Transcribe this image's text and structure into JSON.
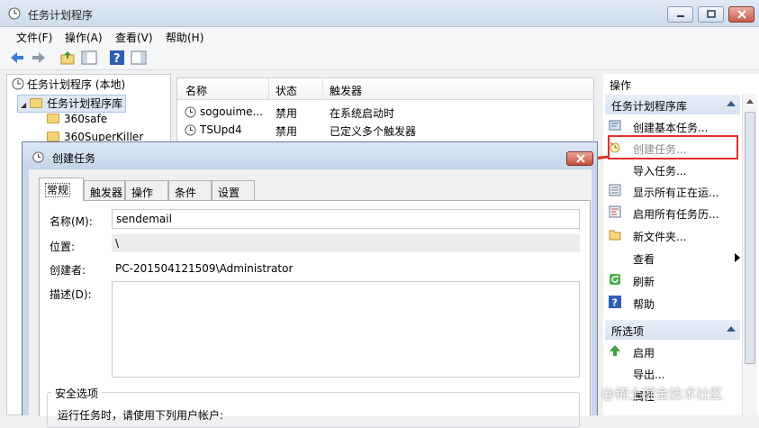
{
  "window": {
    "title": "任务计划程序"
  },
  "menu": [
    "文件(F)",
    "操作(A)",
    "查看(V)",
    "帮助(H)"
  ],
  "tree": {
    "root": "任务计划程序 (本地)",
    "library": "任务计划程序库",
    "folders": [
      "360safe",
      "360SuperKiller"
    ]
  },
  "list": {
    "columns": [
      "名称",
      "状态",
      "触发器"
    ],
    "rows": [
      {
        "name": "sogouime...",
        "status": "禁用",
        "trigger": "在系统启动时"
      },
      {
        "name": "TSUpd4",
        "status": "禁用",
        "trigger": "已定义多个触发器"
      }
    ]
  },
  "actions": {
    "header": "操作",
    "section1": "任务计划程序库",
    "items": [
      {
        "label": "创建基本任务...",
        "icon": "create-basic-task-icon"
      },
      {
        "label": "创建任务...",
        "icon": "create-task-icon"
      },
      {
        "label": "导入任务...",
        "icon": ""
      },
      {
        "label": "显示所有正在运...",
        "icon": "running-tasks-icon"
      },
      {
        "label": "启用所有任务历...",
        "icon": "history-icon"
      },
      {
        "label": "新文件夹...",
        "icon": "folder-icon"
      },
      {
        "label": "查看",
        "icon": ""
      },
      {
        "label": "刷新",
        "icon": "refresh-icon"
      },
      {
        "label": "帮助",
        "icon": "help-icon"
      }
    ],
    "section2": "所选项",
    "items2": [
      {
        "label": "启用",
        "icon": "enable-arrow-icon"
      },
      {
        "label": "导出...",
        "icon": ""
      },
      {
        "label": "属性",
        "icon": ""
      }
    ]
  },
  "dialog": {
    "title": "创建任务",
    "tabs": [
      "常规",
      "触发器",
      "操作",
      "条件",
      "设置"
    ],
    "name_label": "名称(M):",
    "name_value": "sendemail",
    "location_label": "位置:",
    "location_value": "\\",
    "author_label": "创建者:",
    "author_value": "PC-201504121509\\Administrator",
    "desc_label": "描述(D):",
    "desc_value": "",
    "security_title": "安全选项",
    "security_text": "运行任务时，请使用下列用户帐户:"
  },
  "watermark": "@稀土掘金技术社区",
  "colors": {
    "highlight": "#e0302a",
    "arrow": "#e0302a"
  }
}
